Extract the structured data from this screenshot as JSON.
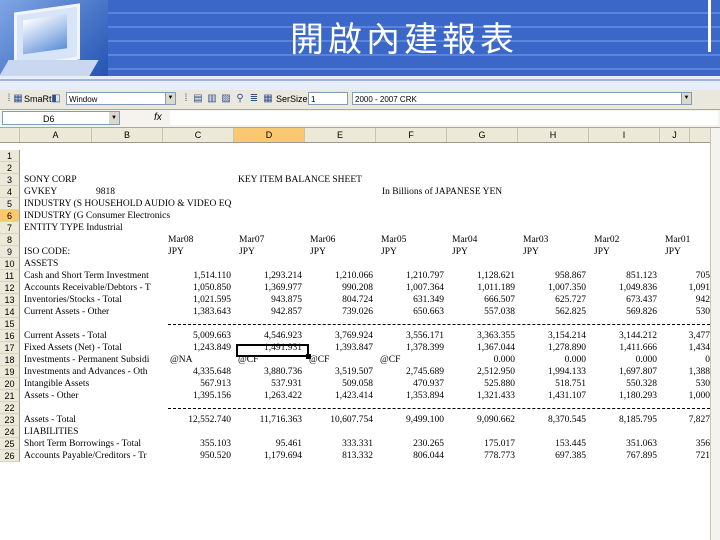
{
  "slide": {
    "title": "開啟內建報表"
  },
  "toolbar": {
    "app_label": "SmaRt",
    "window_combo": "Window",
    "size_label": "SerSize",
    "size_value": "1",
    "range_value": "2000 - 2007 CRK"
  },
  "formula_bar": {
    "name_box": "D6",
    "fx": "fx"
  },
  "columns": [
    "A",
    "B",
    "C",
    "D",
    "E",
    "F",
    "G",
    "H",
    "I",
    "J"
  ],
  "active_column": "D",
  "active_row": "6",
  "rows": [
    "1",
    "2",
    "3",
    "4",
    "5",
    "6",
    "7",
    "8",
    "9",
    "10",
    "11",
    "12",
    "13",
    "14",
    "15",
    "16",
    "17",
    "18",
    "19",
    "20",
    "21",
    "22",
    "23",
    "24",
    "25",
    "26"
  ],
  "sheet": {
    "r3_a": "SONY CORP",
    "r3_d": "KEY ITEM BALANCE SHEET",
    "r4_a": "GVKEY",
    "r4_b": "9818",
    "r4_f": "In Billions of JAPANESE YEN",
    "r5_a": "INDUSTRY (S HOUSEHOLD AUDIO & VIDEO EQ",
    "r6_a": "INDUSTRY (G Consumer Electronics",
    "r7_a": "ENTITY TYPE Industrial",
    "years": [
      "Mar08",
      "Mar07",
      "Mar06",
      "Mar05",
      "Mar04",
      "Mar03",
      "Mar02",
      "Mar01"
    ],
    "r9_a": "ISO CODE:",
    "currencies": [
      "JPY",
      "JPY",
      "JPY",
      "JPY",
      "JPY",
      "JPY",
      "JPY",
      "JPY"
    ],
    "r10_a": "ASSETS",
    "r11_a": "Cash and Short Term Investment",
    "r11_vals": [
      "1,514.110",
      "1,293.214",
      "1,210.066",
      "1,210.797",
      "1,128.621",
      "958.867",
      "851.123",
      "705"
    ],
    "r12_a": "Accounts Receivable/Debtors - T",
    "r12_vals": [
      "1,050.850",
      "1,369.977",
      "990.208",
      "1,007.364",
      "1,011.189",
      "1,007.350",
      "1,049.836",
      "1,091"
    ],
    "r13_a": "Inventories/Stocks - Total",
    "r13_vals": [
      "1,021.595",
      "943.875",
      "804.724",
      "631.349",
      "666.507",
      "625.727",
      "673.437",
      "942"
    ],
    "r14_a": "Current Assets - Other",
    "r14_vals": [
      "1,383.643",
      "942.857",
      "739.026",
      "650.663",
      "557.038",
      "562.825",
      "569.826",
      "530"
    ],
    "r16_a": "Current Assets - Total",
    "r16_vals": [
      "5,009.663",
      "4,546.923",
      "3,769.924",
      "3,556.171",
      "3,363.355",
      "3,154.214",
      "3,144.212",
      "3,477"
    ],
    "r17_a": "Fixed Assets (Net) - Total",
    "r17_vals": [
      "1,243.849",
      "1,491.931",
      "1,393.847",
      "1,378.399",
      "1,367.044",
      "1,278.890",
      "1,411.666",
      "1,434"
    ],
    "r18_a": "Investments - Permanent Subsidi",
    "r18_b": "@NA",
    "r18_vals": [
      "@CF",
      "@CF",
      "@CF",
      "0.000",
      "0.000",
      "0.000",
      "0"
    ],
    "r19_a": "Investments and Advances - Oth",
    "r19_vals": [
      "4,335.648",
      "3,880.736",
      "3,519.507",
      "2,745.689",
      "2,512.950",
      "1,994.133",
      "1,697.807",
      "1,388"
    ],
    "r20_a": "Intangible Assets",
    "r20_vals": [
      "567.913",
      "537.931",
      "509.058",
      "470.937",
      "525.880",
      "518.751",
      "550.328",
      "530"
    ],
    "r21_a": "Assets - Other",
    "r21_vals": [
      "1,395.156",
      "1,263.422",
      "1,423.414",
      "1,353.894",
      "1,321.433",
      "1,431.107",
      "1,180.293",
      "1,000"
    ],
    "r23_a": "Assets - Total",
    "r23_vals": [
      "12,552.740",
      "11,716.363",
      "10,607.754",
      "9,499.100",
      "9,090.662",
      "8,370.545",
      "8,185.795",
      "7,827"
    ],
    "r24_a": "LIABILITIES",
    "r25_a": "Short Term Borrowings - Total",
    "r25_vals": [
      "355.103",
      "95.461",
      "333.331",
      "230.265",
      "175.017",
      "153.445",
      "351.063",
      "356"
    ],
    "r26_a": "Accounts Payable/Creditors - Tr",
    "r26_vals": [
      "950.520",
      "1,179.694",
      "813.332",
      "806.044",
      "778.773",
      "697.385",
      "767.895",
      "721"
    ]
  }
}
